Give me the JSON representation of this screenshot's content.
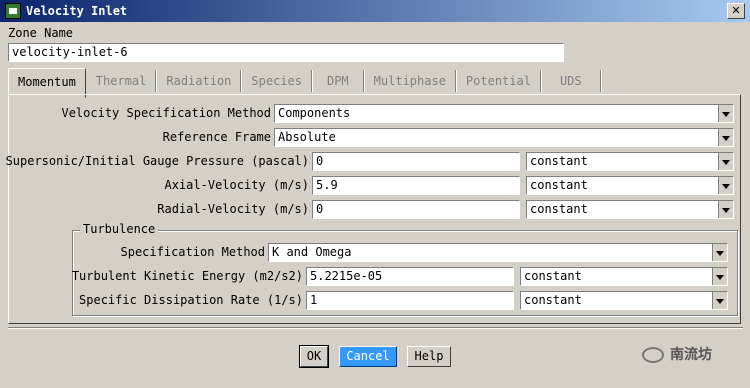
{
  "window": {
    "title": "Velocity Inlet",
    "close_glyph": "✕"
  },
  "zone": {
    "label": "Zone Name",
    "value": "velocity-inlet-6"
  },
  "tabs": [
    {
      "label": "Momentum",
      "active": true
    },
    {
      "label": "Thermal",
      "active": false
    },
    {
      "label": "Radiation",
      "active": false
    },
    {
      "label": "Species",
      "active": false
    },
    {
      "label": "DPM",
      "active": false
    },
    {
      "label": "Multiphase",
      "active": false
    },
    {
      "label": "Potential",
      "active": false
    },
    {
      "label": "UDS",
      "active": false
    }
  ],
  "momentum": {
    "velocity_spec": {
      "label": "Velocity Specification Method",
      "value": "Components"
    },
    "reference_frame": {
      "label": "Reference Frame",
      "value": "Absolute"
    },
    "pressure": {
      "label": "Supersonic/Initial Gauge Pressure (pascal)",
      "value": "0",
      "profile": "constant"
    },
    "axial": {
      "label": "Axial-Velocity (m/s)",
      "value": "5.9",
      "profile": "constant"
    },
    "radial": {
      "label": "Radial-Velocity (m/s)",
      "value": "0",
      "profile": "constant"
    }
  },
  "turbulence": {
    "legend": "Turbulence",
    "spec_method": {
      "label": "Specification Method",
      "value": "K and Omega"
    },
    "tke": {
      "label": "Turbulent Kinetic Energy (m2/s2)",
      "value": "5.2215e-05",
      "profile": "constant"
    },
    "sdr": {
      "label": "Specific Dissipation Rate (1/s)",
      "value": "1",
      "profile": "constant"
    }
  },
  "buttons": {
    "ok": "OK",
    "cancel": "Cancel",
    "help": "Help"
  },
  "watermark": {
    "text": "南流坊"
  },
  "colors": {
    "titlebar_start": "#0a246a",
    "titlebar_end": "#a6caf0",
    "cancel_bg": "#3399ff"
  }
}
